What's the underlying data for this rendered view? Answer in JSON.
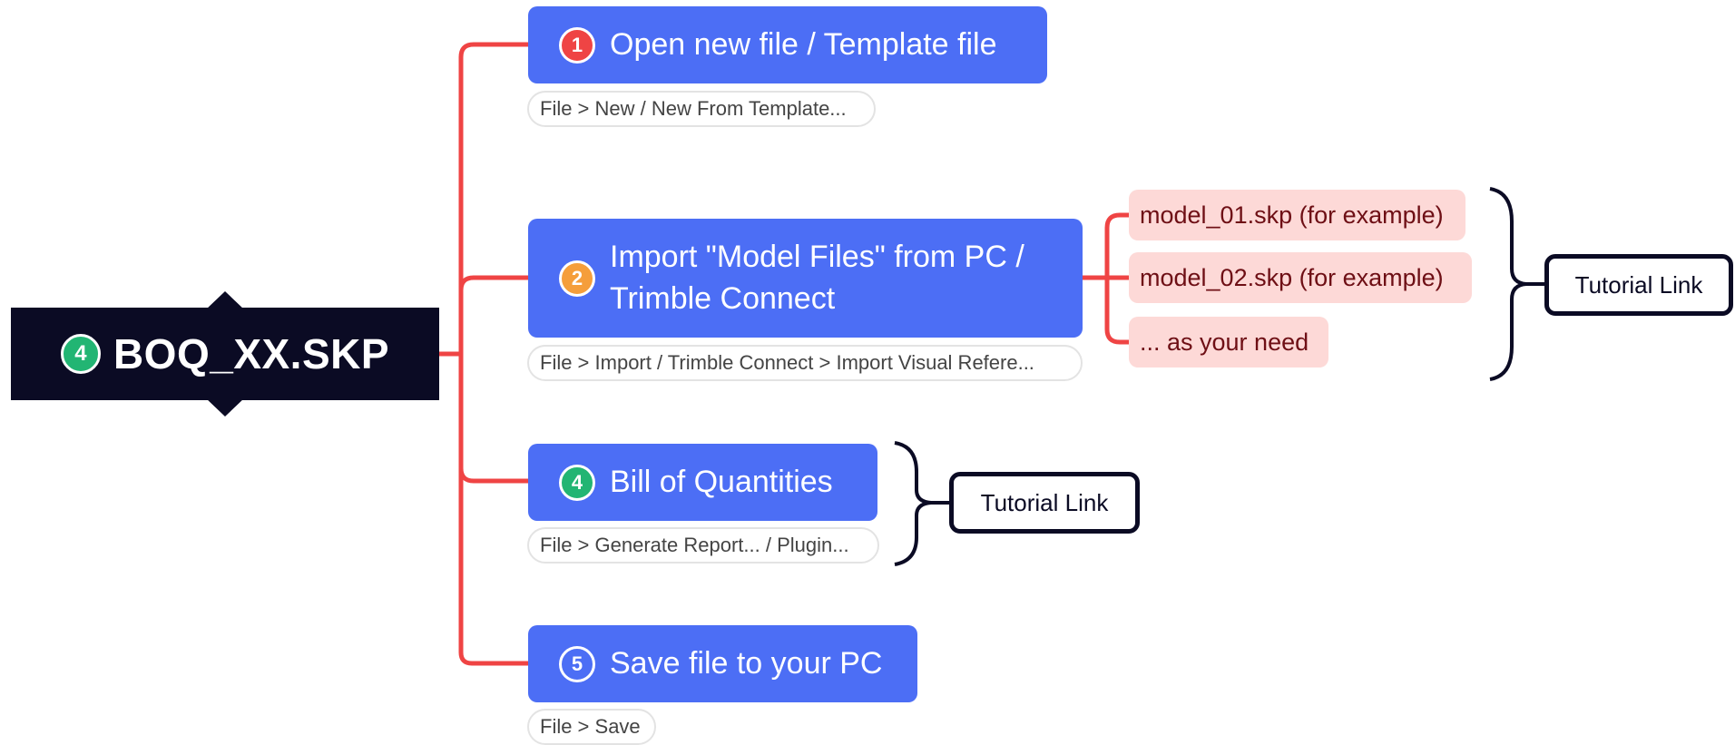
{
  "root": {
    "title": "BOQ_XX.SKP",
    "badge": "4"
  },
  "topics": [
    {
      "badge": "1",
      "label": "Open new file / Template file",
      "note": "File > New / New From Template..."
    },
    {
      "badge": "2",
      "label_line1": "Import \"Model Files\" from PC /",
      "label_line2": "Trimble Connect",
      "note": "File > Import / Trimble Connect > Import Visual Refere..."
    },
    {
      "badge": "4",
      "label": "Bill of Quantities",
      "note": "File > Generate Report... / Plugin..."
    },
    {
      "badge": "5",
      "label": "Save file to your PC",
      "note": "File > Save"
    }
  ],
  "subtopics": [
    "model_01.skp (for example)",
    "model_02.skp (for example)",
    "... as your need"
  ],
  "summaries": {
    "import_link": "Tutorial Link",
    "boq_link": "Tutorial Link"
  },
  "colors": {
    "root": "#0b0b24",
    "topic": "#4c6ef5",
    "connector": "#ef4444",
    "subtopic_bg": "#fdd9d7",
    "subtopic_text": "#6e0f15"
  }
}
